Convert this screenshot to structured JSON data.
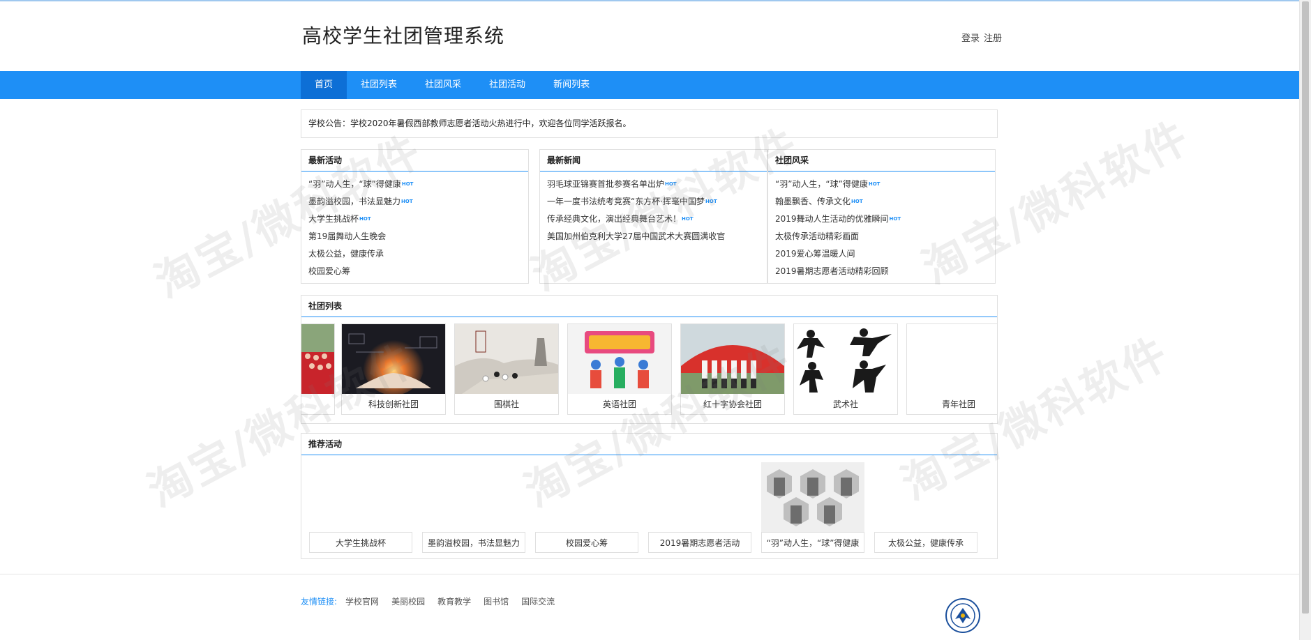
{
  "header": {
    "site_title": "高校学生社团管理系统",
    "login": "登录",
    "register": "注册"
  },
  "nav": [
    {
      "label": "首页",
      "active": true
    },
    {
      "label": "社团列表",
      "active": false
    },
    {
      "label": "社团风采",
      "active": false
    },
    {
      "label": "社团活动",
      "active": false
    },
    {
      "label": "新闻列表",
      "active": false
    }
  ],
  "notice": "学校公告：学校2020年暑假西部教师志愿者活动火热进行中，欢迎各位同学活跃报名。",
  "hot_badge": "HOT",
  "latest_activities": {
    "title": "最新活动",
    "items": [
      {
        "text": "“羽”动人生，“球”得健康",
        "hot": true
      },
      {
        "text": "墨韵溢校园，书法显魅力",
        "hot": true
      },
      {
        "text": "大学生挑战杯",
        "hot": true
      },
      {
        "text": "第19届舞动人生晚会",
        "hot": false
      },
      {
        "text": "太极公益，健康传承",
        "hot": false
      },
      {
        "text": "校园爱心筹",
        "hot": false
      }
    ]
  },
  "latest_news": {
    "title": "最新新闻",
    "items": [
      {
        "text": "羽毛球亚锦赛首批参赛名单出炉",
        "hot": true
      },
      {
        "text": "一年一度书法统考竞赛“东方杯·挥毫中国梦",
        "hot": true
      },
      {
        "text": "传承经典文化，演出经典舞台艺术！",
        "hot": true
      },
      {
        "text": "美国加州伯克利大学27届中国武术大赛圆满收官",
        "hot": false
      }
    ]
  },
  "club_style": {
    "title": "社团风采",
    "items": [
      {
        "text": "“羽”动人生，“球”得健康",
        "hot": true
      },
      {
        "text": "翰墨飘香、传承文化",
        "hot": true
      },
      {
        "text": "2019舞动人生活动的优雅瞬间",
        "hot": true
      },
      {
        "text": "太极传承活动精彩画面",
        "hot": false
      },
      {
        "text": "2019爱心筹温暖人间",
        "hot": false
      },
      {
        "text": "2019暑期志愿者活动精彩回顾",
        "hot": false
      }
    ]
  },
  "club_list": {
    "title": "社团列表",
    "cards": [
      {
        "caption": "",
        "image": "red-group-photo"
      },
      {
        "caption": "科技创新社团",
        "image": "tech-hand-glow"
      },
      {
        "caption": "围棋社",
        "image": "go-board-ink"
      },
      {
        "caption": "英语社团",
        "image": "english-contest-poster"
      },
      {
        "caption": "红十字协会社团",
        "image": "red-cross-group"
      },
      {
        "caption": "武术社",
        "image": "martial-arts-silhouettes"
      },
      {
        "caption": "青年社团",
        "image": ""
      }
    ]
  },
  "recommended": {
    "title": "推荐活动",
    "cards": [
      {
        "caption": "大学生挑战杯",
        "image": ""
      },
      {
        "caption": "墨韵溢校园，书法显魅力",
        "image": ""
      },
      {
        "caption": "校园爱心筹",
        "image": ""
      },
      {
        "caption": "2019暑期志愿者活动",
        "image": ""
      },
      {
        "caption": "“羽”动人生，“球”得健康",
        "image": "hexagon-photo-collage"
      },
      {
        "caption": "太极公益，健康传承",
        "image": ""
      }
    ]
  },
  "footer": {
    "links_label": "友情链接:",
    "links": [
      "学校官网",
      "美丽校园",
      "教育教学",
      "图书馆",
      "国际交流"
    ]
  },
  "watermark": "淘宝/微科软件",
  "colors": {
    "accent": "#1e8ff6",
    "nav_active": "#0d6fd6"
  }
}
